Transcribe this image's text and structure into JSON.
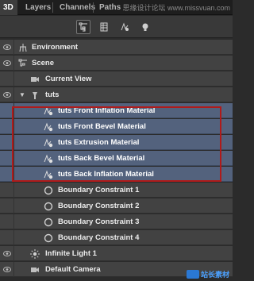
{
  "tabs": [
    {
      "label": "3D",
      "active": true
    },
    {
      "label": "Layers",
      "active": false
    },
    {
      "label": "Channels",
      "active": false
    },
    {
      "label": "Paths",
      "active": false
    }
  ],
  "watermark": "思缘设计论坛 www.missvuan.com",
  "toolbar": {
    "tools": [
      "scene-filter-icon",
      "mesh-filter-icon",
      "material-filter-icon",
      "light-filter-icon"
    ],
    "selected_tool": "scene-filter-icon"
  },
  "tree": [
    {
      "name": "Environment",
      "icon": "environment-icon",
      "eye": true
    },
    {
      "name": "Scene",
      "icon": "scene-icon",
      "eye": true
    },
    {
      "name": "Current View",
      "icon": "camera-icon",
      "eye": false
    },
    {
      "name": "tuts",
      "icon": "mesh-icon",
      "eye": true,
      "expanded": true
    },
    {
      "name": "tuts Front Inflation Material",
      "icon": "material-icon",
      "eye": false,
      "selected": true
    },
    {
      "name": "tuts Front Bevel Material",
      "icon": "material-icon",
      "eye": false,
      "selected": true
    },
    {
      "name": "tuts Extrusion Material",
      "icon": "material-icon",
      "eye": false,
      "selected": true
    },
    {
      "name": "tuts Back Bevel Material",
      "icon": "material-icon",
      "eye": false,
      "selected": true
    },
    {
      "name": "tuts Back Inflation Material",
      "icon": "material-icon",
      "eye": false,
      "selected": true
    },
    {
      "name": "Boundary Constraint 1",
      "icon": "constraint-icon",
      "eye": false
    },
    {
      "name": "Boundary Constraint 2",
      "icon": "constraint-icon",
      "eye": false
    },
    {
      "name": "Boundary Constraint 3",
      "icon": "constraint-icon",
      "eye": false
    },
    {
      "name": "Boundary Constraint 4",
      "icon": "constraint-icon",
      "eye": false
    },
    {
      "name": "Infinite Light 1",
      "icon": "light-icon",
      "eye": true
    },
    {
      "name": "Default Camera",
      "icon": "camera-icon",
      "eye": true
    }
  ],
  "logo_text": "站长素材",
  "colors": {
    "panel": "#424242",
    "selected": "#53627d",
    "highlight_border": "#b01a1a"
  }
}
